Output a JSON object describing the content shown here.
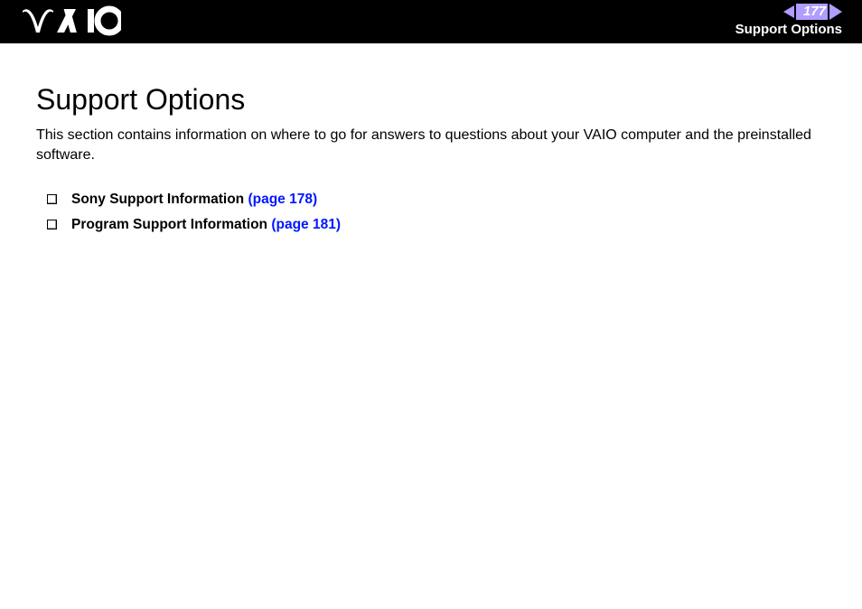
{
  "header": {
    "page_number": "177",
    "section": "Support Options"
  },
  "content": {
    "title": "Support Options",
    "intro": "This section contains information on where to go for answers to questions about your VAIO computer and the preinstalled software.",
    "items": [
      {
        "label": "Sony Support Information ",
        "link": "(page 178)"
      },
      {
        "label": "Program Support Information ",
        "link": "(page 181)"
      }
    ]
  }
}
